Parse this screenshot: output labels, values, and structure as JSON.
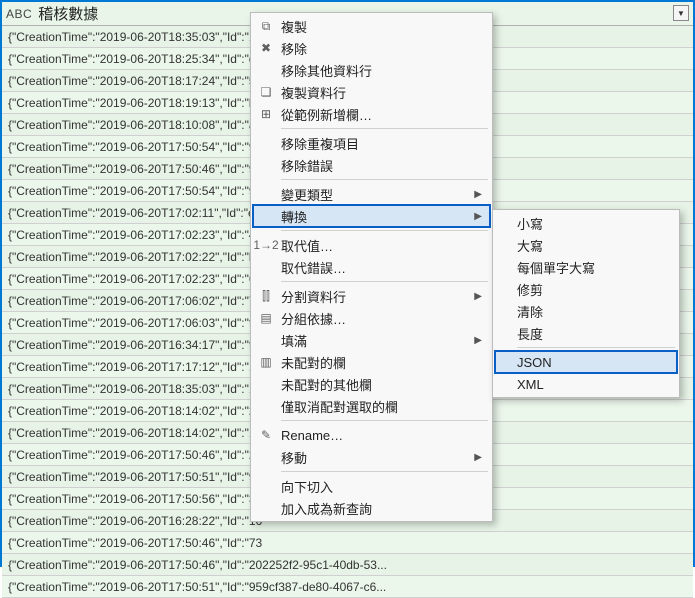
{
  "column": {
    "type_label": "ABC",
    "title": "稽核數據"
  },
  "rows": [
    "{\"CreationTime\":\"2019-06-20T18:35:03\",\"Id\":\"1c",
    "{\"CreationTime\":\"2019-06-20T18:25:34\",\"Id\":\"d0",
    "{\"CreationTime\":\"2019-06-20T18:17:24\",\"Id\":\"50",
    "{\"CreationTime\":\"2019-06-20T18:19:13\",\"Id\":\"b3",
    "{\"CreationTime\":\"2019-06-20T18:10:08\",\"Id\":\"a5",
    "{\"CreationTime\":\"2019-06-20T17:50:54\",\"Id\":\"97",
    "{\"CreationTime\":\"2019-06-20T17:50:46\",\"Id\":\"97",
    "{\"CreationTime\":\"2019-06-20T17:50:54\",\"Id\":\"97",
    "{\"CreationTime\":\"2019-06-20T17:02:11\",\"Id\":\"ed",
    "{\"CreationTime\":\"2019-06-20T17:02:23\",\"Id\":\"4a",
    "{\"CreationTime\":\"2019-06-20T17:02:22\",\"Id\":\"b3",
    "{\"CreationTime\":\"2019-06-20T17:02:23\",\"Id\":\"69",
    "{\"CreationTime\":\"2019-06-20T17:06:02\",\"Id\":\"70",
    "{\"CreationTime\":\"2019-06-20T17:06:03\",\"Id\":\"fd",
    "{\"CreationTime\":\"2019-06-20T16:34:17\",\"Id\":\"f7",
    "{\"CreationTime\":\"2019-06-20T17:17:12\",\"Id\":\"15",
    "{\"CreationTime\":\"2019-06-20T18:35:03\",\"Id\":\"1c",
    "{\"CreationTime\":\"2019-06-20T18:14:02\",\"Id\":\"29",
    "{\"CreationTime\":\"2019-06-20T18:14:02\",\"Id\":\"12",
    "{\"CreationTime\":\"2019-06-20T17:50:46\",\"Id\":\"20",
    "{\"CreationTime\":\"2019-06-20T17:50:51\",\"Id\":\"95",
    "{\"CreationTime\":\"2019-06-20T17:50:56\",\"Id\":\"3c",
    "{\"CreationTime\":\"2019-06-20T16:28:22\",\"Id\":\"16",
    "{\"CreationTime\":\"2019-06-20T17:50:46\",\"Id\":\"73",
    "{\"CreationTime\":\"2019-06-20T17:50:46\",\"Id\":\"202252f2-95c1-40db-53...",
    "{\"CreationTime\":\"2019-06-20T17:50:51\",\"Id\":\"959cf387-de80-4067-c6..."
  ],
  "menu": {
    "items": [
      {
        "icon": "copy-icon",
        "label": "複製",
        "arrow": false
      },
      {
        "icon": "remove-icon",
        "label": "移除",
        "arrow": false
      },
      {
        "icon": "",
        "label": "移除其他資料行",
        "arrow": false
      },
      {
        "icon": "dup-icon",
        "label": "複製資料行",
        "arrow": false
      },
      {
        "icon": "example-icon",
        "label": "從範例新增欄…",
        "arrow": false
      },
      {
        "sep": true
      },
      {
        "icon": "",
        "label": "移除重複項目",
        "arrow": false
      },
      {
        "icon": "",
        "label": "移除錯誤",
        "arrow": false
      },
      {
        "sep": true
      },
      {
        "icon": "",
        "label": "變更類型",
        "arrow": true
      },
      {
        "icon": "",
        "label": "轉換",
        "arrow": true,
        "highlight": true
      },
      {
        "sep": true
      },
      {
        "icon": "replace-icon",
        "label": "取代值…",
        "arrow": false
      },
      {
        "icon": "",
        "label": "取代錯誤…",
        "arrow": false
      },
      {
        "sep": true
      },
      {
        "icon": "split-icon",
        "label": "分割資料行",
        "arrow": true
      },
      {
        "icon": "group-icon",
        "label": "分組依據…",
        "arrow": false
      },
      {
        "icon": "",
        "label": "填滿",
        "arrow": true
      },
      {
        "icon": "unpivot-icon",
        "label": "未配對的欄",
        "arrow": false
      },
      {
        "icon": "",
        "label": "未配對的其他欄",
        "arrow": false
      },
      {
        "icon": "",
        "label": "僅取消配對選取的欄",
        "arrow": false
      },
      {
        "sep": true
      },
      {
        "icon": "rename-icon",
        "label": "Rename…",
        "arrow": false
      },
      {
        "icon": "",
        "label": "移動",
        "arrow": true
      },
      {
        "sep": true
      },
      {
        "icon": "",
        "label": "向下切入",
        "arrow": false
      },
      {
        "icon": "",
        "label": "加入成為新查詢",
        "arrow": false
      }
    ]
  },
  "submenu": {
    "items": [
      {
        "label": "小寫"
      },
      {
        "label": "大寫"
      },
      {
        "label": "每個單字大寫"
      },
      {
        "label": "修剪"
      },
      {
        "label": "清除"
      },
      {
        "label": "長度"
      },
      {
        "sep": true
      },
      {
        "label": "JSON",
        "highlight": true
      },
      {
        "label": "XML"
      }
    ]
  },
  "icons": {
    "copy-icon": "⧉",
    "remove-icon": "✖",
    "dup-icon": "❏",
    "example-icon": "⊞",
    "replace-icon": "1→2",
    "split-icon": "⫿⫿",
    "group-icon": "▤",
    "unpivot-icon": "▥",
    "rename-icon": "✎"
  }
}
